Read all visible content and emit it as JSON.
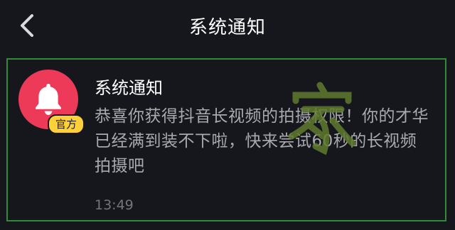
{
  "header": {
    "title": "系统通知",
    "back_icon": "chevron-left-icon"
  },
  "notification": {
    "sender": "系统通知",
    "avatar_icon": "bell-icon",
    "badge": "官方",
    "message": "恭喜你获得抖音长视频的拍摄权限！你的才华已经满到装不下啦，快来尝试60秒的长视频拍摄吧",
    "time": "13:49"
  },
  "colors": {
    "background": "#16171c",
    "avatar": "#ee3a59",
    "badge": "#fed13a",
    "card_border": "#2f8a3a"
  }
}
